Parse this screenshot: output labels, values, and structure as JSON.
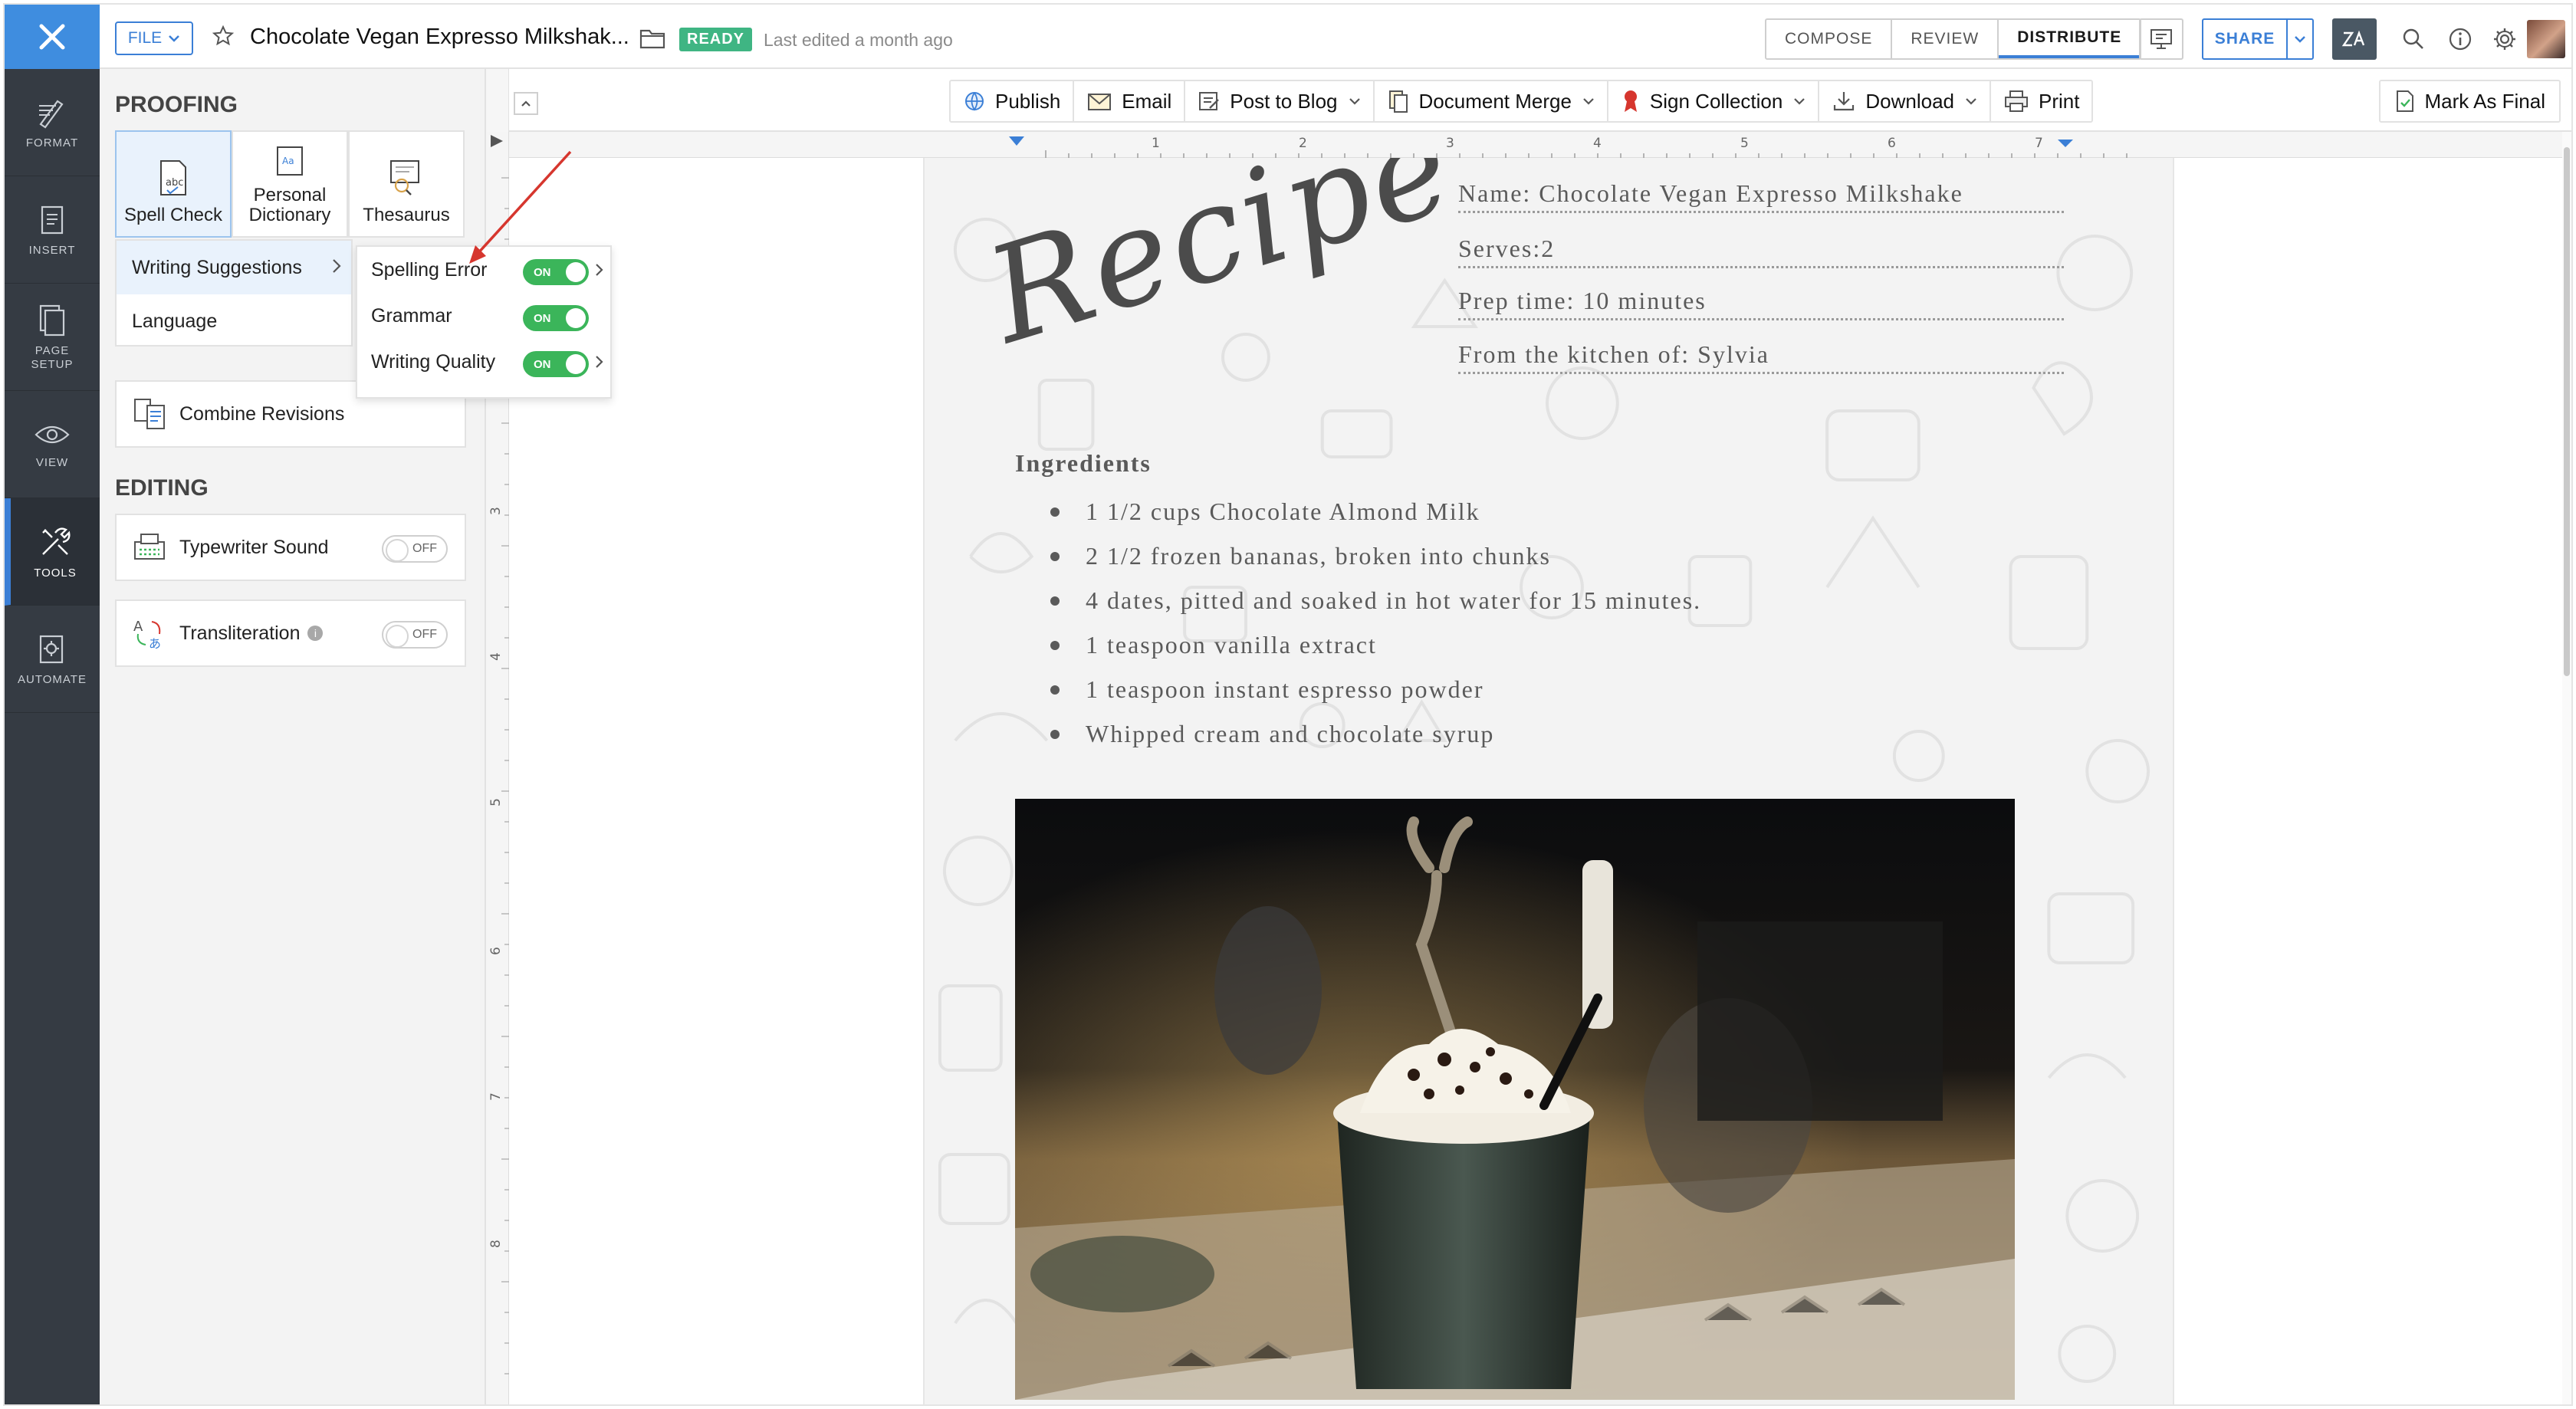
{
  "header": {
    "file_label": "FILE",
    "doc_title": "Chocolate Vegan Expresso Milkshak...",
    "status_badge": "READY",
    "last_edited": "Last edited a month ago",
    "modes": [
      "COMPOSE",
      "REVIEW",
      "DISTRIBUTE"
    ],
    "active_mode": "DISTRIBUTE",
    "share_label": "SHARE"
  },
  "rail": {
    "items": [
      {
        "label": "FORMAT",
        "icon": "format-icon"
      },
      {
        "label": "INSERT",
        "icon": "insert-icon"
      },
      {
        "label": "PAGE SETUP",
        "icon": "page-setup-icon"
      },
      {
        "label": "VIEW",
        "icon": "eye-icon"
      },
      {
        "label": "TOOLS",
        "icon": "tools-icon"
      },
      {
        "label": "AUTOMATE",
        "icon": "automate-icon"
      }
    ],
    "active": "TOOLS"
  },
  "panel": {
    "proofing_heading": "PROOFING",
    "tiles": [
      {
        "label": "Spell Check",
        "icon": "spell-check-icon"
      },
      {
        "label": "Personal Dictionary",
        "icon": "dictionary-icon"
      },
      {
        "label": "Thesaurus",
        "icon": "thesaurus-icon"
      }
    ],
    "menu": [
      {
        "label": "Writing Suggestions"
      },
      {
        "label": "Language"
      }
    ],
    "combine_revisions": "Combine Revisions",
    "editing_heading": "EDITING",
    "typewriter_sound": "Typewriter Sound",
    "transliteration": "Transliteration",
    "toggle_off_text": "OFF"
  },
  "submenu": {
    "items": [
      {
        "label": "Spelling Error",
        "state": "ON"
      },
      {
        "label": "Grammar",
        "state": "ON"
      },
      {
        "label": "Writing Quality",
        "state": "ON"
      }
    ]
  },
  "actions": {
    "publish": "Publish",
    "email": "Email",
    "post_to_blog": "Post to Blog",
    "document_merge": "Document Merge",
    "sign_collection": "Sign Collection",
    "download": "Download",
    "print": "Print",
    "mark_as_final": "Mark As Final"
  },
  "ruler": {
    "h_labels": [
      "1",
      "2",
      "3",
      "4",
      "5",
      "6",
      "7"
    ],
    "v_labels": [
      "3",
      "4",
      "5",
      "6",
      "7",
      "8"
    ]
  },
  "document": {
    "recipe_word": "Recipe",
    "name_field": "Name: Chocolate Vegan Expresso Milkshake",
    "serves_field": "Serves:2",
    "prep_field": "Prep time: 10 minutes",
    "kitchen_field": "From the kitchen of: Sylvia",
    "ingredients_heading": "Ingredients",
    "ingredients": [
      "1 1/2 cups Chocolate Almond Milk",
      "2 1/2 frozen bananas, broken into chunks",
      "4 dates, pitted and soaked in hot water for 15 minutes.",
      "1 teaspoon vanilla extract",
      "1 teaspoon instant espresso powder",
      "Whipped cream and chocolate syrup"
    ]
  },
  "colors": {
    "accent": "#3b7fd6",
    "rail_bg": "#353b43",
    "ready_green": "#3fb583",
    "toggle_on_green": "#3bb55a",
    "annotation_red": "#d6362e"
  }
}
